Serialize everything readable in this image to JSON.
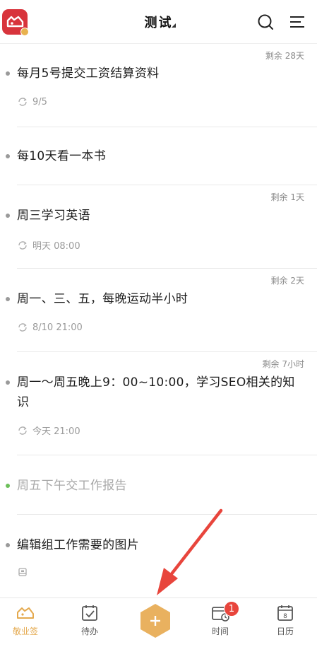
{
  "header": {
    "title": "测试",
    "icons": {
      "logo": "app-logo-icon",
      "search": "search-icon",
      "menu": "menu-icon"
    }
  },
  "items": [
    {
      "title": "每月5号提交工资结算资料",
      "remain": "剩余 28天",
      "meta": "9/5",
      "meta_icon": "repeat-icon",
      "done": false
    },
    {
      "title": "每10天看一本书",
      "remain": "",
      "meta": "",
      "meta_icon": "",
      "done": false
    },
    {
      "title": "周三学习英语",
      "remain": "剩余 1天",
      "meta": "明天 08:00",
      "meta_icon": "repeat-icon",
      "done": false
    },
    {
      "title": "周一、三、五，每晚运动半小时",
      "remain": "剩余 2天",
      "meta": "8/10 21:00",
      "meta_icon": "repeat-icon",
      "done": false
    },
    {
      "title": "周一～周五晚上9：00~10:00，学习SEO相关的知识",
      "remain": "剩余 7小时",
      "meta": "今天 21:00",
      "meta_icon": "repeat-icon",
      "done": false
    },
    {
      "title": "周五下午交工作报告",
      "remain": "",
      "meta": "",
      "meta_icon": "",
      "done": true
    },
    {
      "title": "编辑组工作需要的图片",
      "remain": "",
      "meta": "",
      "meta_icon": "attachment-icon",
      "done": false
    }
  ],
  "bottom_nav": {
    "tabs": [
      {
        "label": "敬业签",
        "icon": "note-logo-icon",
        "active": true
      },
      {
        "label": "待办",
        "icon": "todo-check-icon",
        "active": false
      },
      {
        "label": "时间",
        "icon": "time-calendar-icon",
        "active": false,
        "badge": "1"
      },
      {
        "label": "日历",
        "icon": "calendar-icon",
        "active": false,
        "day": "8"
      }
    ],
    "add_icon": "plus-icon"
  },
  "colors": {
    "accent": "#e4a94e",
    "brand_red": "#d8343c",
    "badge_red": "#e8453c",
    "arrow_red": "#e8453c"
  }
}
